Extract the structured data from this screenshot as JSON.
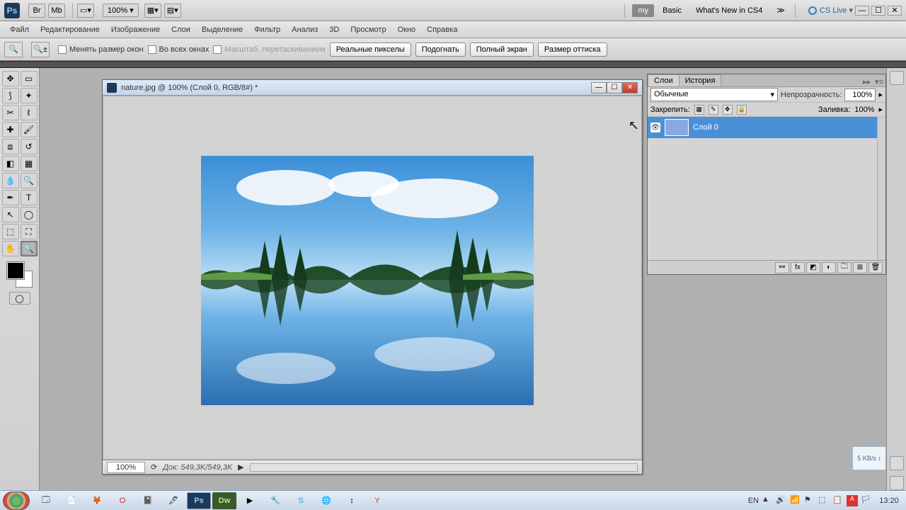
{
  "app": {
    "logo_text": "Ps",
    "zoom": "100%  ▾",
    "workspace_buttons": {
      "my": "my",
      "basic": "Basic",
      "whatsnew": "What's New in CS4"
    },
    "more": "≫",
    "cslive": "CS Live ▾"
  },
  "menubar": [
    "Файл",
    "Редактирование",
    "Изображение",
    "Слои",
    "Выделение",
    "Фильтр",
    "Анализ",
    "3D",
    "Просмотр",
    "Окно",
    "Справка"
  ],
  "options_bar": {
    "chk_resize": "Менять размер окон",
    "chk_allwin": "Во всех окнах",
    "chk_scrubby": "Масштаб. перетаскиванием",
    "btn_actualpx": "Реальные пикселы",
    "btn_fit": "Подогнать",
    "btn_full": "Полный экран",
    "btn_print": "Размер оттиска"
  },
  "document": {
    "title": "nature.jpg @ 100% (Слой 0, RGB/8#) *",
    "status_zoom": "100%",
    "status_doc": "Док: 549,3K/549,3K"
  },
  "layers_panel": {
    "tab_layers": "Слои",
    "tab_history": "История",
    "blend_mode": "Обычные",
    "opacity_label": "Непрозрачность:",
    "opacity_value": "100%",
    "lock_label": "Закрепить:",
    "fill_label": "Заливка:",
    "fill_value": "100%",
    "layer0_name": "Слой 0"
  },
  "net_widget": "5 KB/s ↕",
  "taskbar": {
    "lang": "EN",
    "time": "13:20"
  },
  "colors": {
    "accent": "#4a90d9"
  }
}
